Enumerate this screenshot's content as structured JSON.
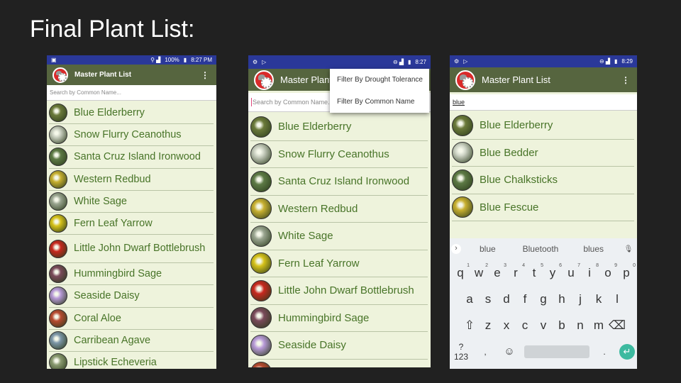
{
  "slide_title": "Final Plant List:",
  "screens": [
    {
      "status_time": "8:27 PM",
      "status_battery": "100%",
      "app_title": "Master Plant List",
      "search_placeholder": "Search by Common Name...",
      "search_value": "",
      "items": [
        {
          "name": "Blue Elderberry",
          "color": "#6b7a3a"
        },
        {
          "name": "Snow Flurry Ceanothus",
          "color": "#c9cfc0"
        },
        {
          "name": "Santa Cruz Island Ironwood",
          "color": "#5d7a45"
        },
        {
          "name": "Western Redbud",
          "color": "#c8b030"
        },
        {
          "name": "White Sage",
          "color": "#9aa590"
        },
        {
          "name": "Fern Leaf Yarrow",
          "color": "#d6c21a"
        },
        {
          "name": "Little John Dwarf Bottlebrush",
          "color": "#c8281e"
        },
        {
          "name": "Hummingbird Sage",
          "color": "#7a4a5a"
        },
        {
          "name": "Seaside Daisy",
          "color": "#b89ad8"
        },
        {
          "name": "Coral Aloe",
          "color": "#b84a30"
        },
        {
          "name": "Carribean Agave",
          "color": "#7d96a8"
        },
        {
          "name": "Lipstick Echeveria",
          "color": "#8a9a70"
        }
      ]
    },
    {
      "status_time": "8:27",
      "app_title": "Master Plant List",
      "search_placeholder": "Search by Common Name...",
      "search_value": "",
      "menu": [
        "Filter By Drought Tolerance",
        "Filter By Common Name"
      ],
      "items": [
        {
          "name": "Blue Elderberry",
          "color": "#6b7a3a"
        },
        {
          "name": "Snow Flurry Ceanothus",
          "color": "#c9cfc0"
        },
        {
          "name": "Santa Cruz Island Ironwood",
          "color": "#5d7a45"
        },
        {
          "name": "Western Redbud",
          "color": "#c8b030"
        },
        {
          "name": "White Sage",
          "color": "#9aa590"
        },
        {
          "name": "Fern Leaf Yarrow",
          "color": "#d6c21a"
        },
        {
          "name": "Little John Dwarf Bottlebrush",
          "color": "#c8281e"
        },
        {
          "name": "Hummingbird Sage",
          "color": "#7a4a5a"
        },
        {
          "name": "Seaside Daisy",
          "color": "#b89ad8"
        },
        {
          "name": "",
          "color": "#b84a30"
        }
      ]
    },
    {
      "status_time": "8:29",
      "app_title": "Master Plant List",
      "search_placeholder": "",
      "search_value": "blue",
      "items": [
        {
          "name": "Blue Elderberry",
          "color": "#6b7a3a"
        },
        {
          "name": "Blue Bedder",
          "color": "#d0d6c8"
        },
        {
          "name": "Blue Chalksticks",
          "color": "#5d7a45"
        },
        {
          "name": "Blue Fescue",
          "color": "#c8b030"
        }
      ],
      "keyboard": {
        "suggestions": [
          "blue",
          "Bluetooth",
          "blues"
        ],
        "row1": [
          "q",
          "w",
          "e",
          "r",
          "t",
          "y",
          "u",
          "i",
          "o",
          "p"
        ],
        "digits": [
          "1",
          "2",
          "3",
          "4",
          "5",
          "6",
          "7",
          "8",
          "9",
          "0"
        ],
        "row2": [
          "a",
          "s",
          "d",
          "f",
          "g",
          "h",
          "j",
          "k",
          "l"
        ],
        "row3": [
          "z",
          "x",
          "c",
          "v",
          "b",
          "n",
          "m"
        ],
        "symbols_key": "?123",
        "comma": ",",
        "period": ".",
        "accent": "#3dbaa0"
      }
    }
  ]
}
